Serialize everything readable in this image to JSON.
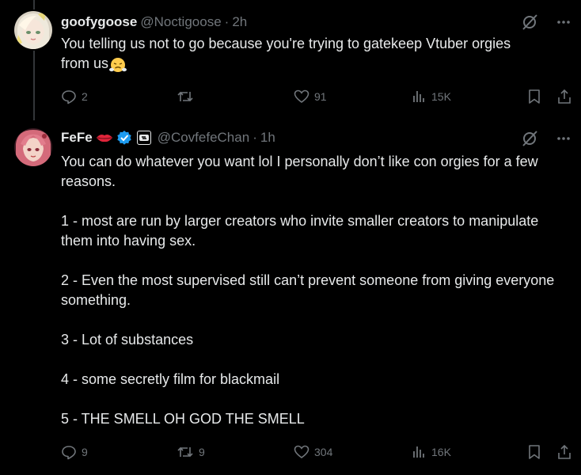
{
  "tweets": [
    {
      "name": "goofygoose",
      "handle": "@Noctigoose",
      "time": "2h",
      "text_lines": [
        "You telling us not to go because you're trying to gatekeep Vtuber orgies",
        "from us"
      ],
      "emoji": "face-with-steam-from-nose",
      "replies": "2",
      "reposts": "",
      "likes": "91",
      "views": "15K"
    },
    {
      "name": "FeFe",
      "name_emoji": "lips-emoji",
      "handle": "@CovfefeChan",
      "time": "1h",
      "paragraphs": [
        "You can do whatever you want lol I personally don’t like con orgies for a few reasons.",
        "",
        "1 - most are run by larger creators who invite smaller creators to manipulate them into having sex.",
        "",
        "2 - Even the most supervised still can’t prevent someone from giving everyone something.",
        "",
        "3 - Lot of substances",
        "",
        "4 - some secretly film for blackmail",
        "",
        "5 - THE SMELL OH GOD THE SMELL"
      ],
      "replies": "9",
      "reposts": "9",
      "likes": "304",
      "views": "16K"
    }
  ],
  "colors": {
    "background": "#000000",
    "text": "#e7e9ea",
    "muted": "#71767b",
    "verified": "#1d9bf0",
    "thread_line": "#333639"
  }
}
